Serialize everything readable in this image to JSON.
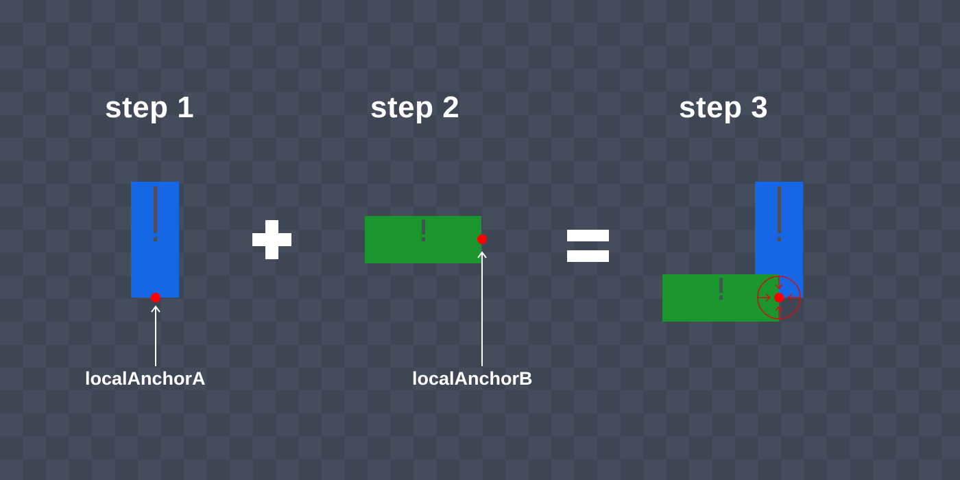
{
  "steps": {
    "step1": "step 1",
    "step2": "step 2",
    "step3": "step 3"
  },
  "labels": {
    "anchor_a": "localAnchorA",
    "anchor_b": "localAnchorB"
  },
  "operators": {
    "plus": "+",
    "equals": "="
  },
  "colors": {
    "body_a": "#1766e5",
    "body_b": "#1b962e",
    "anchor": "#ff0000",
    "mark": "#4a4f5a",
    "text": "#ffffff"
  }
}
